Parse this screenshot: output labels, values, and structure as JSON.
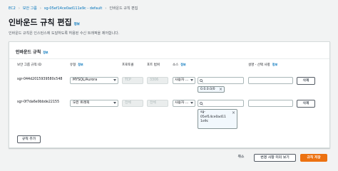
{
  "breadcrumb": {
    "items": [
      "EC2",
      "보안 그룹",
      "sg-05ef14ce0ad111e9c - default",
      "인바운드 규칙 편집"
    ]
  },
  "page": {
    "title": "인바운드 규칙 편집",
    "info": "정보",
    "description": "인바운드 규칙은 인스턴스에 도달하도록 허용된 수신 트래픽을 제어합니다."
  },
  "panel": {
    "title": "인바운드 규칙",
    "info": "정보",
    "columns": {
      "id": "보안 그룹 규칙 ID",
      "type": "유형",
      "protocol": "프로토콜",
      "port": "포트 범위",
      "source": "소스",
      "description": "설명 - 선택 사항"
    }
  },
  "rules": [
    {
      "id": "sgr-044d2015939580c548",
      "type": "MYSQL/Aurora",
      "protocol": "TCP",
      "port": "3306",
      "source": "사용자 ...",
      "token": "0.0.0.0/0",
      "delete": "삭제"
    },
    {
      "id": "sgr-0f7da6e9bbde22155",
      "type": "모든 트래픽",
      "protocol": "전체",
      "port": "전체",
      "source": "사용자 ...",
      "token_lines": [
        "sg-",
        "05ef14ce0ad11",
        "1e9c"
      ],
      "delete": "삭제"
    }
  ],
  "buttons": {
    "add_rule": "규칙 추가",
    "cancel": "취소",
    "preview": "변경 사항 미리 보기",
    "save": "규칙 저장"
  },
  "colors": {
    "link": "#0073bb",
    "primary": "#ec7211"
  }
}
